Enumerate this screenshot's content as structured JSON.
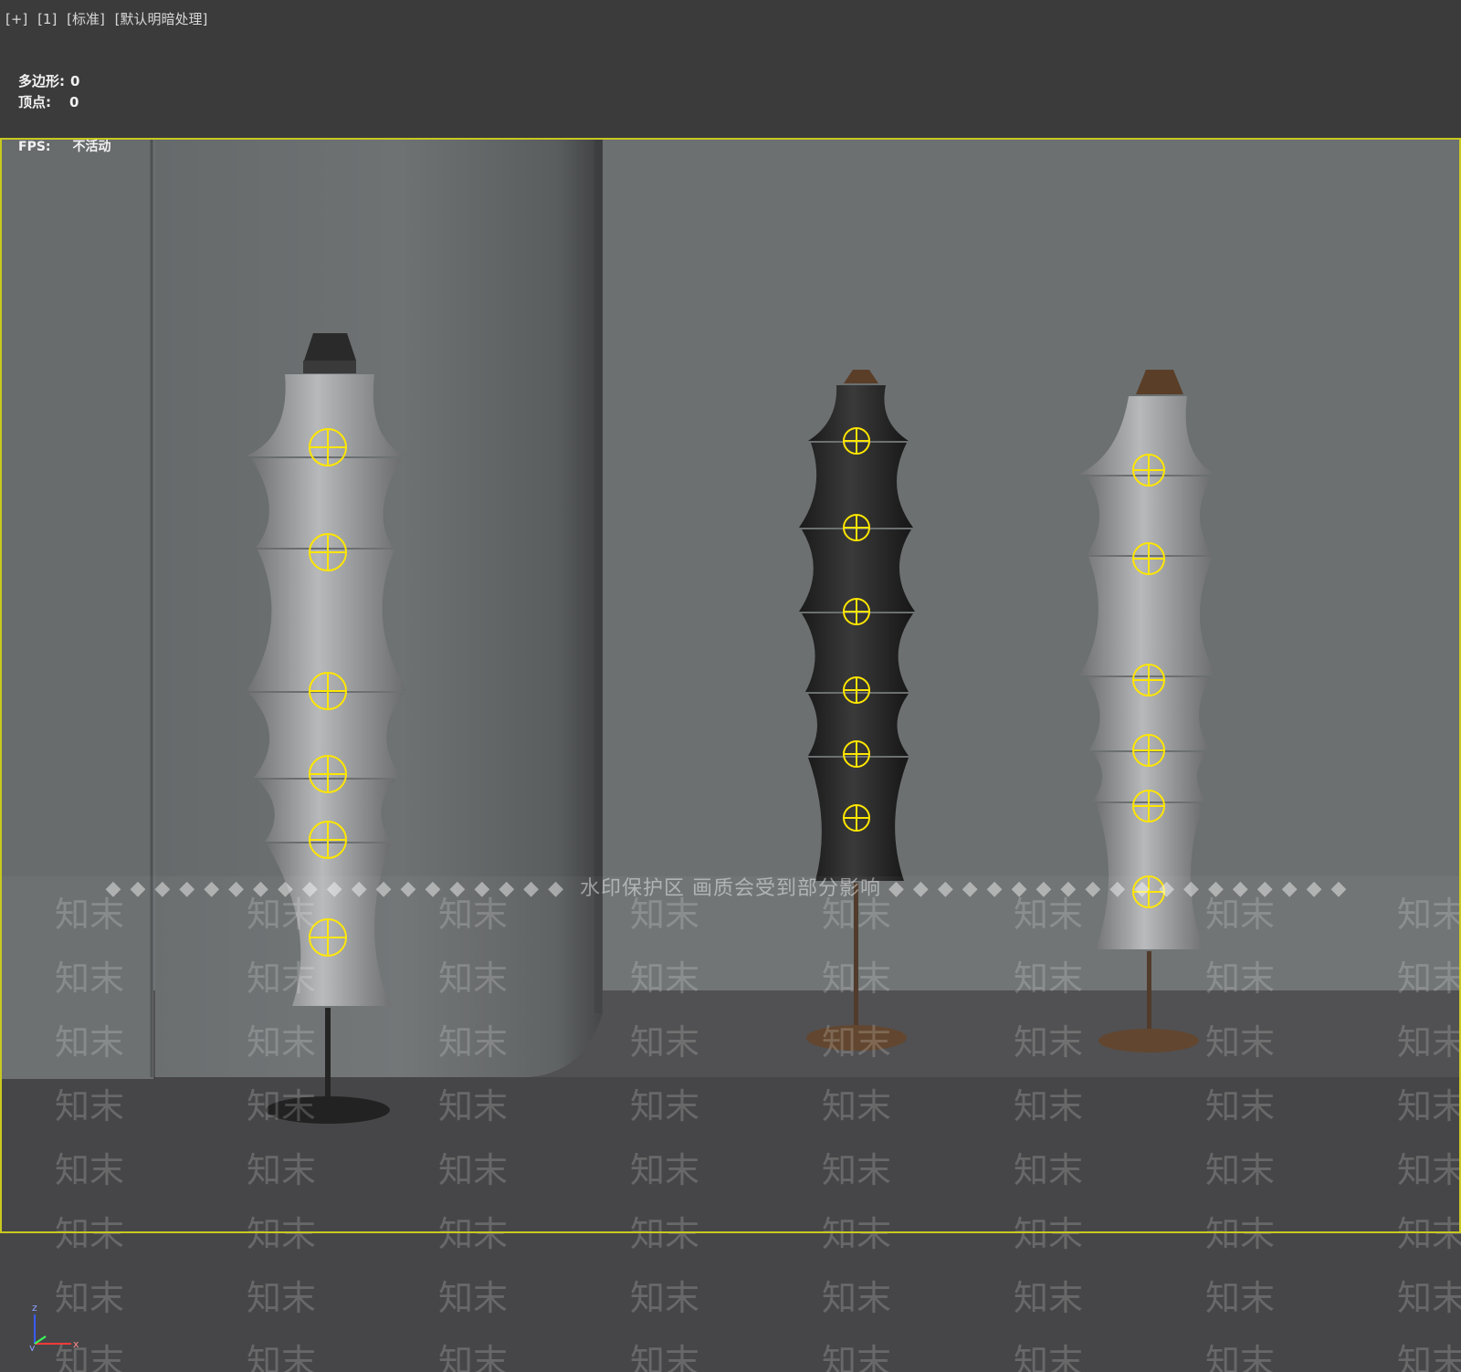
{
  "viewport": {
    "labels": [
      "[+]",
      "[1]",
      "[标准]",
      "[默认明暗处理]"
    ],
    "stats": {
      "polygons_label": "多边形:",
      "polygons_value": "0",
      "vertices_label": "顶点:",
      "vertices_value": "0"
    },
    "fps": {
      "label": "FPS:",
      "value": "不活动"
    },
    "watermark": {
      "banner": "水印保护区   画质会受到部分影响",
      "tile_text": "知末"
    },
    "axis": {
      "z": "z",
      "y": "y",
      "x": "x"
    }
  },
  "colors": {
    "top_bar": "#3b3b3b",
    "wall": "#6c7071",
    "floor": "#4a4a4c",
    "viewport_border": "#c8c820",
    "light_gizmo": "#ffe600",
    "lamp_white": "#9a9c9e",
    "lamp_black": "#252525",
    "wood": "#6b4a30"
  }
}
